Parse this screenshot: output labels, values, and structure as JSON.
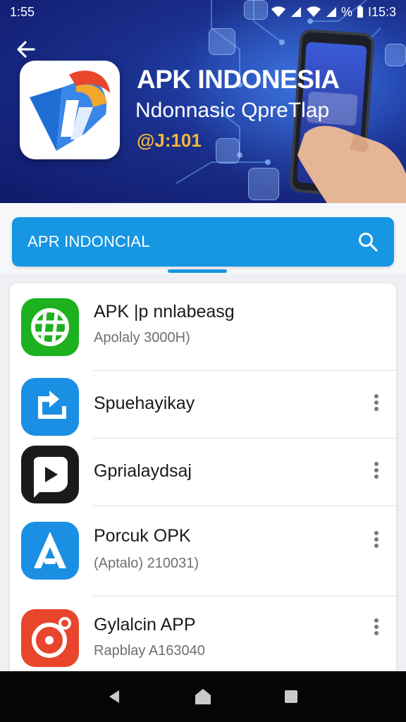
{
  "status_bar": {
    "time": "1:55",
    "battery_percent": "%",
    "right_time": "I15:3"
  },
  "hero": {
    "title": "APK INDONESIA",
    "subtitle": "Ndonnasic QpreTlap",
    "code": "@J:101"
  },
  "search": {
    "query": "APR INDONCIAL"
  },
  "apps": [
    {
      "name": "APK |p nnlabeasg",
      "meta": "Apolaly 3000H)",
      "color": "#1db01f"
    },
    {
      "name": "Spuehayikay",
      "meta": "",
      "color": "#1a8fe3"
    },
    {
      "name": "Gprialaydsaj",
      "meta": "",
      "color": "#1a1a1a"
    },
    {
      "name": "Porcuk OPK",
      "meta": "(Aptalo) 210031)",
      "color": "#1a8fe3"
    },
    {
      "name": "Gylalcin APP",
      "meta": "Rapblay A163040",
      "color": "#e8452c"
    }
  ],
  "colors": {
    "accent": "#1796e3",
    "hero_bg": "#1a2f8c",
    "code_gold": "#f2b73a"
  }
}
